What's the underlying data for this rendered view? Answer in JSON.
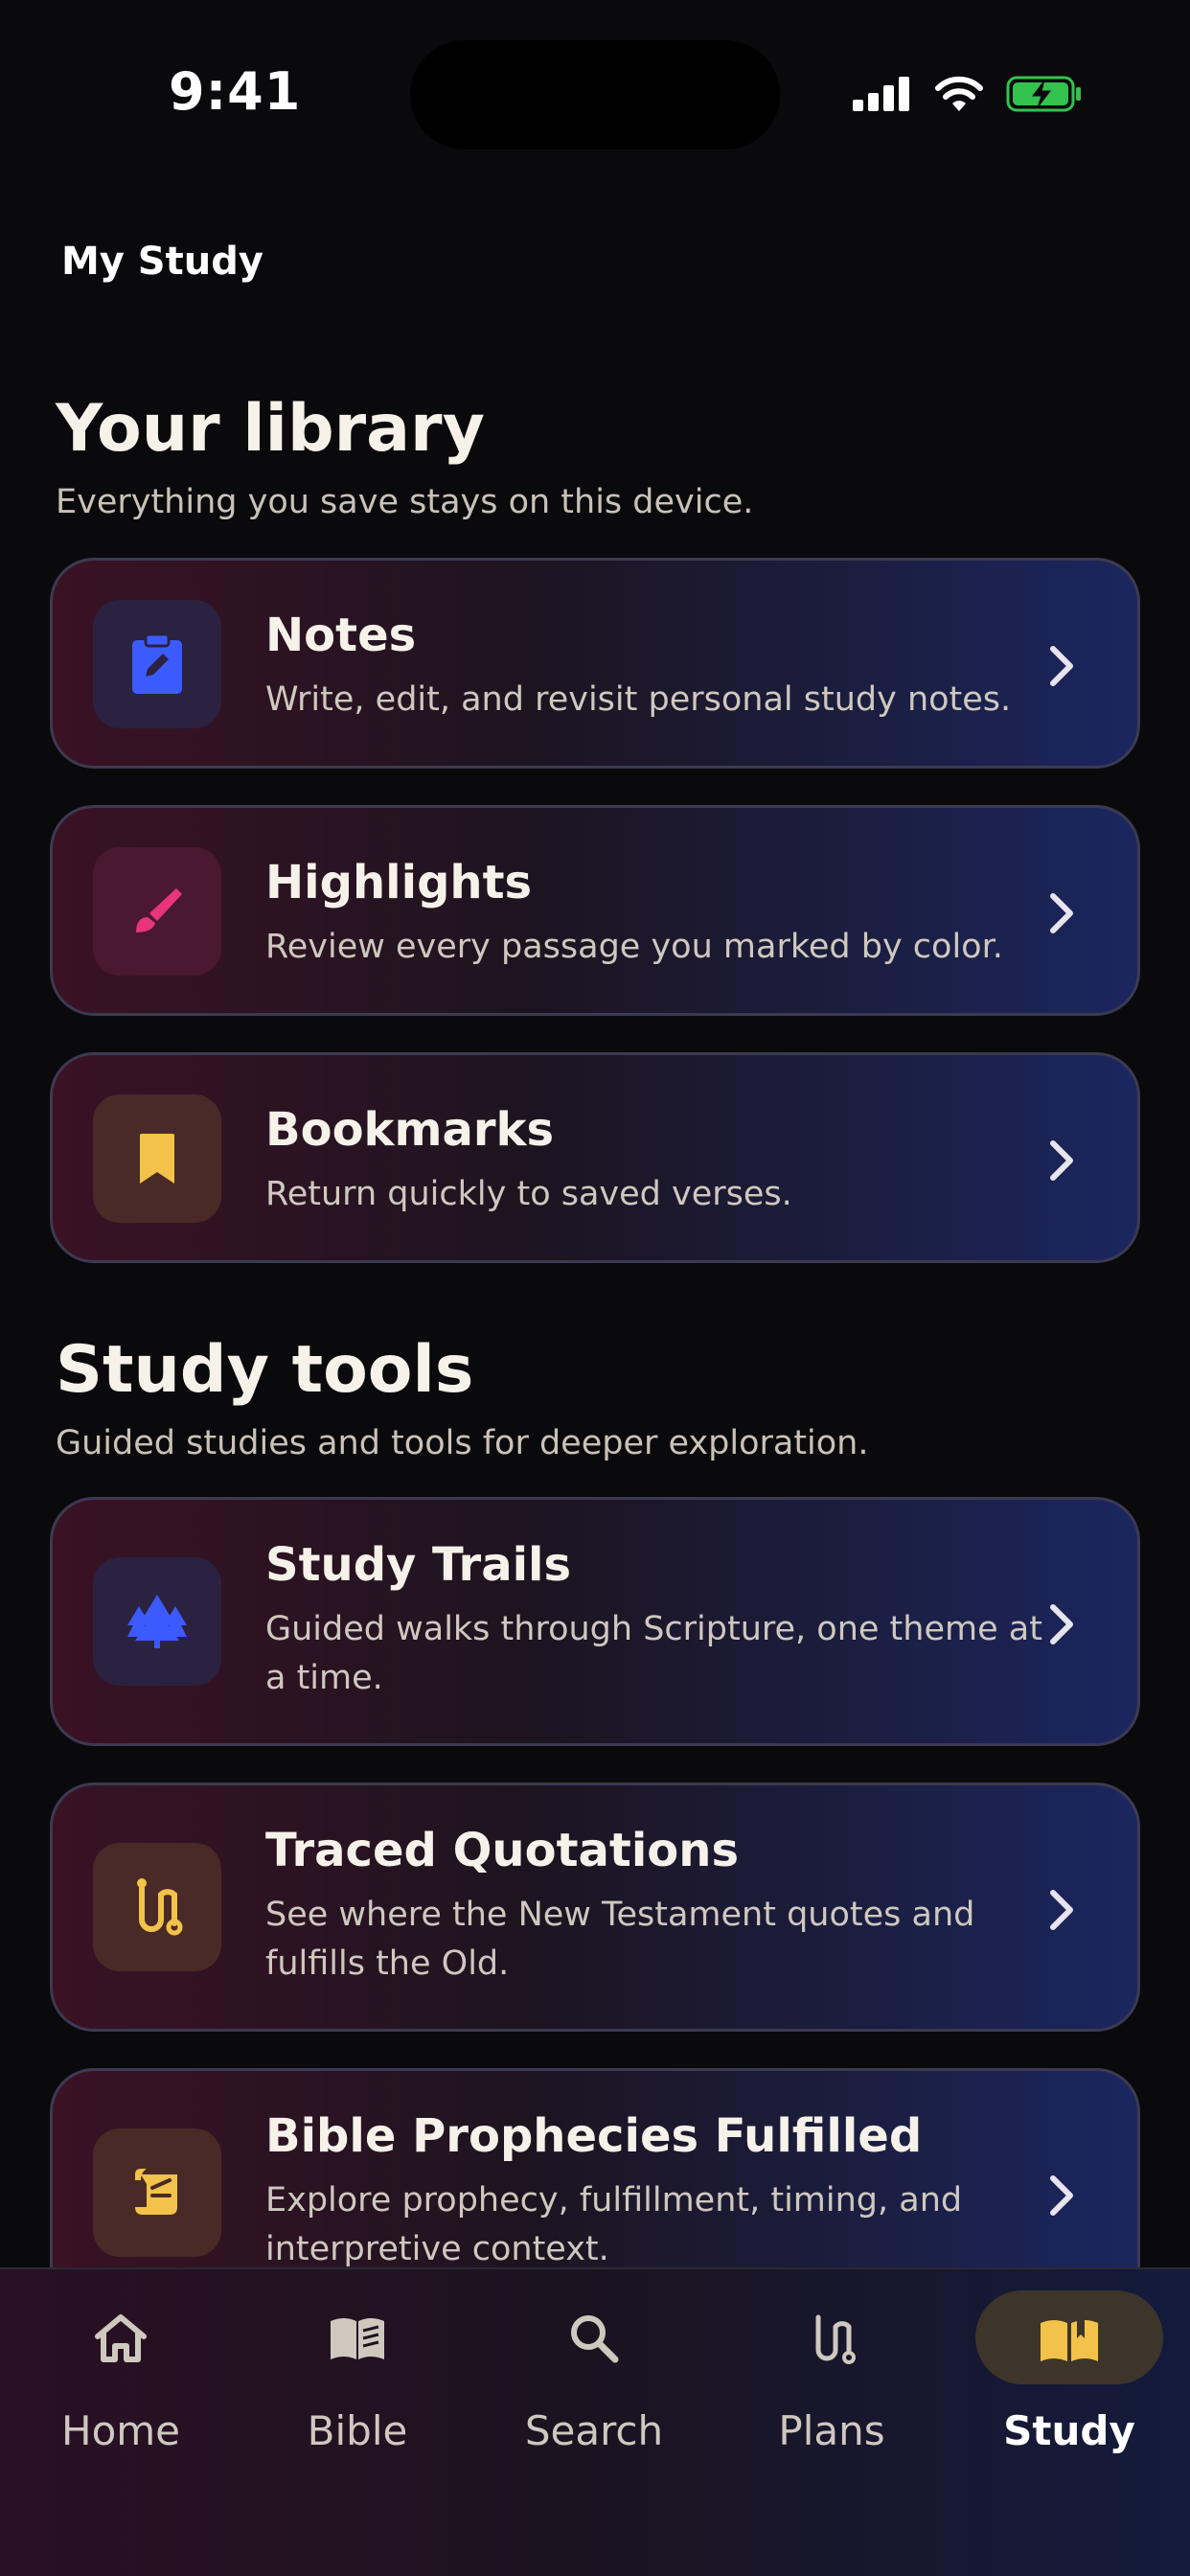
{
  "status": {
    "time": "9:41"
  },
  "header": {
    "title": "My Study"
  },
  "library": {
    "title": "Your library",
    "subtitle": "Everything you save stays on this device.",
    "cards": [
      {
        "title": "Notes",
        "desc": "Write, edit, and revisit personal study notes.",
        "icon": "notes-clipboard-icon",
        "color": "#3b5bff"
      },
      {
        "title": "Highlights",
        "desc": "Review every passage you marked by color.",
        "icon": "brush-icon",
        "color": "#e8347a"
      },
      {
        "title": "Bookmarks",
        "desc": "Return quickly to saved verses.",
        "icon": "bookmark-icon",
        "color": "#f2c24a"
      }
    ]
  },
  "tools": {
    "title": "Study tools",
    "subtitle": "Guided studies and tools for deeper exploration.",
    "cards": [
      {
        "title": "Study Trails",
        "desc": "Guided walks through Scripture, one theme at a time.",
        "icon": "forest-icon",
        "color": "#3b5bff"
      },
      {
        "title": "Traced Quotations",
        "desc": "See where the New Testament quotes and fulfills the Old.",
        "icon": "route-icon",
        "color": "#f2c24a"
      },
      {
        "title": "Bible Prophecies Fulfilled",
        "desc": "Explore prophecy, fulfillment, timing, and interpretive context.",
        "icon": "scroll-icon",
        "color": "#f2c24a"
      }
    ]
  },
  "tabs": [
    {
      "label": "Home",
      "icon": "home-icon"
    },
    {
      "label": "Bible",
      "icon": "book-icon"
    },
    {
      "label": "Search",
      "icon": "search-icon"
    },
    {
      "label": "Plans",
      "icon": "plans-route-icon"
    },
    {
      "label": "Study",
      "icon": "open-book-icon",
      "active": true
    }
  ],
  "colors": {
    "accent": "#f2c24a",
    "background": "#0a0a0c"
  }
}
